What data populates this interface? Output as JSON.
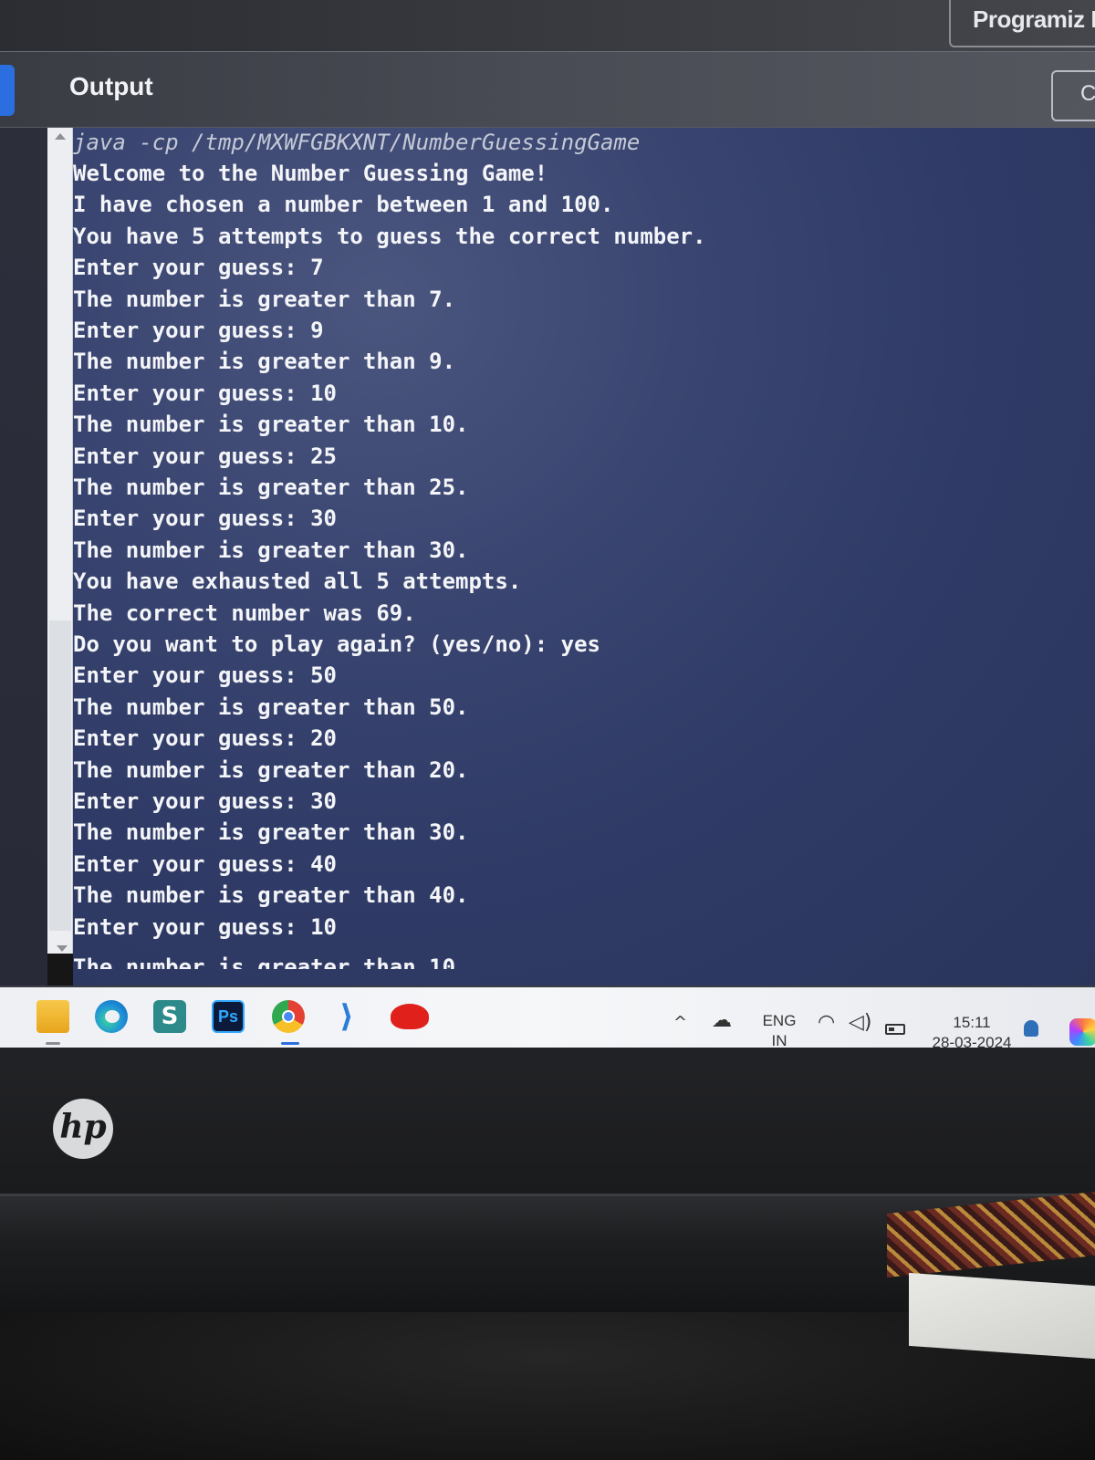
{
  "topbar": {
    "brand": "Programiz P"
  },
  "output_panel": {
    "title": "Output",
    "clear_button_label": "C"
  },
  "console": {
    "command": "java -cp /tmp/MXWFGBKXNT/NumberGuessingGame",
    "lines": [
      "Welcome to the Number Guessing Game!",
      "I have chosen a number between 1 and 100.",
      "You have 5 attempts to guess the correct number.",
      "Enter your guess: 7",
      "The number is greater than 7.",
      "Enter your guess: 9",
      "The number is greater than 9.",
      "Enter your guess: 10",
      "The number is greater than 10.",
      "Enter your guess: 25",
      "The number is greater than 25.",
      "Enter your guess: 30",
      "The number is greater than 30.",
      "You have exhausted all 5 attempts.",
      "The correct number was 69.",
      "Do you want to play again? (yes/no): yes",
      "Enter your guess: 50",
      "The number is greater than 50.",
      "Enter your guess: 20",
      "The number is greater than 20.",
      "Enter your guess: 30",
      "The number is greater than 30.",
      "Enter your guess: 40",
      "The number is greater than 40.",
      "Enter your guess: 10"
    ],
    "partial_line": "The number is greater than 10"
  },
  "taskbar": {
    "apps": [
      "file-explorer-icon",
      "edge-icon",
      "scribd-icon",
      "photoshop-icon",
      "chrome-icon",
      "vscode-icon",
      "redhat-icon"
    ],
    "ps_label": "Ps",
    "language": "ENG",
    "region": "IN",
    "time": "15:11",
    "date": "28-03-2024"
  },
  "laptop": {
    "logo": "hp"
  }
}
